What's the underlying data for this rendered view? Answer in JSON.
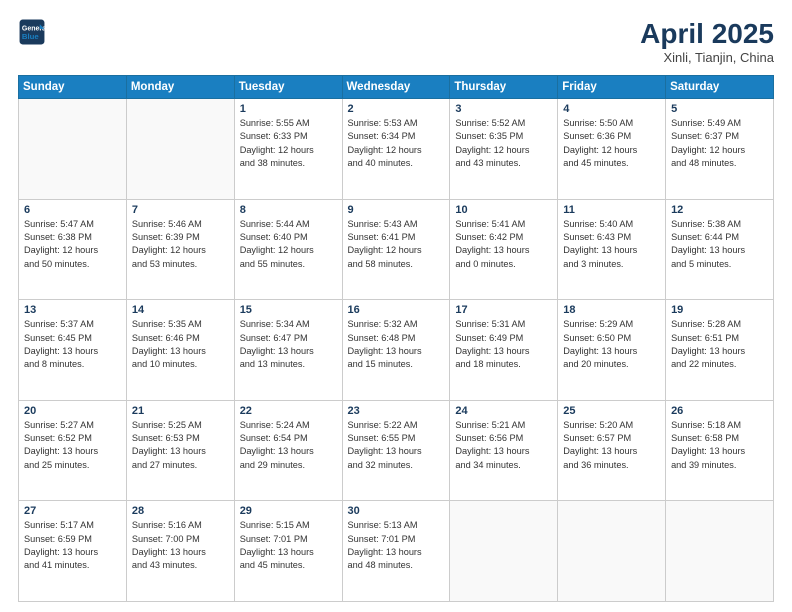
{
  "header": {
    "logo_line1": "General",
    "logo_line2": "Blue",
    "month_year": "April 2025",
    "location": "Xinli, Tianjin, China"
  },
  "weekdays": [
    "Sunday",
    "Monday",
    "Tuesday",
    "Wednesday",
    "Thursday",
    "Friday",
    "Saturday"
  ],
  "weeks": [
    [
      {
        "day": "",
        "info": ""
      },
      {
        "day": "",
        "info": ""
      },
      {
        "day": "1",
        "info": "Sunrise: 5:55 AM\nSunset: 6:33 PM\nDaylight: 12 hours\nand 38 minutes."
      },
      {
        "day": "2",
        "info": "Sunrise: 5:53 AM\nSunset: 6:34 PM\nDaylight: 12 hours\nand 40 minutes."
      },
      {
        "day": "3",
        "info": "Sunrise: 5:52 AM\nSunset: 6:35 PM\nDaylight: 12 hours\nand 43 minutes."
      },
      {
        "day": "4",
        "info": "Sunrise: 5:50 AM\nSunset: 6:36 PM\nDaylight: 12 hours\nand 45 minutes."
      },
      {
        "day": "5",
        "info": "Sunrise: 5:49 AM\nSunset: 6:37 PM\nDaylight: 12 hours\nand 48 minutes."
      }
    ],
    [
      {
        "day": "6",
        "info": "Sunrise: 5:47 AM\nSunset: 6:38 PM\nDaylight: 12 hours\nand 50 minutes."
      },
      {
        "day": "7",
        "info": "Sunrise: 5:46 AM\nSunset: 6:39 PM\nDaylight: 12 hours\nand 53 minutes."
      },
      {
        "day": "8",
        "info": "Sunrise: 5:44 AM\nSunset: 6:40 PM\nDaylight: 12 hours\nand 55 minutes."
      },
      {
        "day": "9",
        "info": "Sunrise: 5:43 AM\nSunset: 6:41 PM\nDaylight: 12 hours\nand 58 minutes."
      },
      {
        "day": "10",
        "info": "Sunrise: 5:41 AM\nSunset: 6:42 PM\nDaylight: 13 hours\nand 0 minutes."
      },
      {
        "day": "11",
        "info": "Sunrise: 5:40 AM\nSunset: 6:43 PM\nDaylight: 13 hours\nand 3 minutes."
      },
      {
        "day": "12",
        "info": "Sunrise: 5:38 AM\nSunset: 6:44 PM\nDaylight: 13 hours\nand 5 minutes."
      }
    ],
    [
      {
        "day": "13",
        "info": "Sunrise: 5:37 AM\nSunset: 6:45 PM\nDaylight: 13 hours\nand 8 minutes."
      },
      {
        "day": "14",
        "info": "Sunrise: 5:35 AM\nSunset: 6:46 PM\nDaylight: 13 hours\nand 10 minutes."
      },
      {
        "day": "15",
        "info": "Sunrise: 5:34 AM\nSunset: 6:47 PM\nDaylight: 13 hours\nand 13 minutes."
      },
      {
        "day": "16",
        "info": "Sunrise: 5:32 AM\nSunset: 6:48 PM\nDaylight: 13 hours\nand 15 minutes."
      },
      {
        "day": "17",
        "info": "Sunrise: 5:31 AM\nSunset: 6:49 PM\nDaylight: 13 hours\nand 18 minutes."
      },
      {
        "day": "18",
        "info": "Sunrise: 5:29 AM\nSunset: 6:50 PM\nDaylight: 13 hours\nand 20 minutes."
      },
      {
        "day": "19",
        "info": "Sunrise: 5:28 AM\nSunset: 6:51 PM\nDaylight: 13 hours\nand 22 minutes."
      }
    ],
    [
      {
        "day": "20",
        "info": "Sunrise: 5:27 AM\nSunset: 6:52 PM\nDaylight: 13 hours\nand 25 minutes."
      },
      {
        "day": "21",
        "info": "Sunrise: 5:25 AM\nSunset: 6:53 PM\nDaylight: 13 hours\nand 27 minutes."
      },
      {
        "day": "22",
        "info": "Sunrise: 5:24 AM\nSunset: 6:54 PM\nDaylight: 13 hours\nand 29 minutes."
      },
      {
        "day": "23",
        "info": "Sunrise: 5:22 AM\nSunset: 6:55 PM\nDaylight: 13 hours\nand 32 minutes."
      },
      {
        "day": "24",
        "info": "Sunrise: 5:21 AM\nSunset: 6:56 PM\nDaylight: 13 hours\nand 34 minutes."
      },
      {
        "day": "25",
        "info": "Sunrise: 5:20 AM\nSunset: 6:57 PM\nDaylight: 13 hours\nand 36 minutes."
      },
      {
        "day": "26",
        "info": "Sunrise: 5:18 AM\nSunset: 6:58 PM\nDaylight: 13 hours\nand 39 minutes."
      }
    ],
    [
      {
        "day": "27",
        "info": "Sunrise: 5:17 AM\nSunset: 6:59 PM\nDaylight: 13 hours\nand 41 minutes."
      },
      {
        "day": "28",
        "info": "Sunrise: 5:16 AM\nSunset: 7:00 PM\nDaylight: 13 hours\nand 43 minutes."
      },
      {
        "day": "29",
        "info": "Sunrise: 5:15 AM\nSunset: 7:01 PM\nDaylight: 13 hours\nand 45 minutes."
      },
      {
        "day": "30",
        "info": "Sunrise: 5:13 AM\nSunset: 7:01 PM\nDaylight: 13 hours\nand 48 minutes."
      },
      {
        "day": "",
        "info": ""
      },
      {
        "day": "",
        "info": ""
      },
      {
        "day": "",
        "info": ""
      }
    ]
  ]
}
